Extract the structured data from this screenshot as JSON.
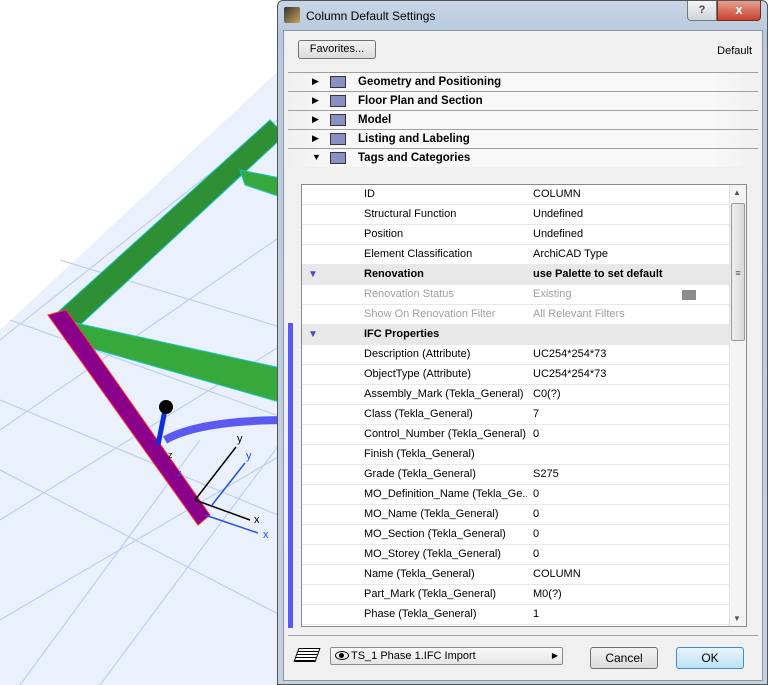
{
  "dialog": {
    "title": "Column Default Settings",
    "help": "?",
    "close": "x",
    "favorites": "Favorites...",
    "default_label": "Default"
  },
  "sections": [
    {
      "label": "Geometry and Positioning",
      "expanded": false,
      "icon": "geometry-icon"
    },
    {
      "label": "Floor Plan and Section",
      "expanded": false,
      "icon": "floor-plan-icon"
    },
    {
      "label": "Model",
      "expanded": false,
      "icon": "model-icon"
    },
    {
      "label": "Listing and Labeling",
      "expanded": false,
      "icon": "listing-icon"
    },
    {
      "label": "Tags and Categories",
      "expanded": true,
      "icon": "tags-icon"
    }
  ],
  "rows": [
    {
      "k": "ID",
      "v": "COLUMN"
    },
    {
      "k": "Structural Function",
      "v": "Undefined"
    },
    {
      "k": "Position",
      "v": "Undefined"
    },
    {
      "k": "Element Classification",
      "v": "ArchiCAD Type"
    },
    {
      "k": "Renovation",
      "v": "use Palette to set default",
      "type": "hdr"
    },
    {
      "k": "Renovation Status",
      "v": "Existing",
      "type": "dim"
    },
    {
      "k": "Show On Renovation Filter",
      "v": "All Relevant Filters",
      "type": "dim"
    },
    {
      "k": "IFC Properties",
      "v": "",
      "type": "hdr"
    },
    {
      "k": "Description (Attribute)",
      "v": "UC254*254*73"
    },
    {
      "k": "ObjectType (Attribute)",
      "v": "UC254*254*73"
    },
    {
      "k": "Assembly_Mark (Tekla_General)",
      "v": "C0(?)"
    },
    {
      "k": "Class (Tekla_General)",
      "v": "7"
    },
    {
      "k": "Control_Number (Tekla_General)",
      "v": "0"
    },
    {
      "k": "Finish (Tekla_General)",
      "v": ""
    },
    {
      "k": "Grade (Tekla_General)",
      "v": "S275"
    },
    {
      "k": "MO_Definition_Name (Tekla_Ge...",
      "v": "0"
    },
    {
      "k": "MO_Name (Tekla_General)",
      "v": "0"
    },
    {
      "k": "MO_Section (Tekla_General)",
      "v": "0"
    },
    {
      "k": "MO_Storey (Tekla_General)",
      "v": "0"
    },
    {
      "k": "Name (Tekla_General)",
      "v": "COLUMN"
    },
    {
      "k": "Part_Mark (Tekla_General)",
      "v": "M0(?)"
    },
    {
      "k": "Phase (Tekla_General)",
      "v": "1"
    }
  ],
  "footer": {
    "layer": "TS_1 Phase 1.IFC Import",
    "cancel": "Cancel",
    "ok": "OK"
  },
  "scene": {
    "axis_labels": [
      "y",
      "y",
      "x",
      "x",
      "z",
      "z"
    ]
  }
}
